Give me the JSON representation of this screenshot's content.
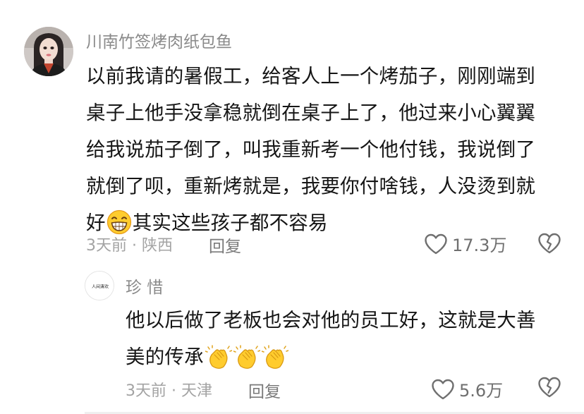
{
  "comments": [
    {
      "username": "川南竹签烤肉纸包鱼",
      "content_lines": [
        "以前我请的暑假工，给客人上一个烤茄子，刚刚端到",
        "桌子上他手没拿稳就倒在桌子上了，他过来小心翼翼",
        "给我说茄子倒了，叫我重新考一个他付钱，我说倒了",
        "就倒了呗，重新烤就是，我要你付啥钱，人没烫到就",
        "好",
        "其实这些孩子都不容易"
      ],
      "emoji": "grinning-face-emoji",
      "time": "3天前",
      "location": "陕西",
      "meta_separator": "·",
      "reply_label": "回复",
      "like_count": "17.3万",
      "avatar": "woman-portrait-avatar"
    },
    {
      "username": "珍 惜",
      "avatar_text": "人间清欢",
      "content_lines": [
        "他以后做了老板也会对他的员工好，这就是大善",
        "美的传承"
      ],
      "emoji": "clapping-hands-emoji",
      "time": "3天前",
      "location": "天津",
      "meta_separator": "·",
      "reply_label": "回复",
      "like_count": "5.6万"
    }
  ],
  "colors": {
    "username": "#8a8a8a",
    "content": "#161616",
    "meta": "#a3a3a3",
    "icon": "#6f6f6f",
    "emoji_yellow": "#ffcc2e"
  }
}
